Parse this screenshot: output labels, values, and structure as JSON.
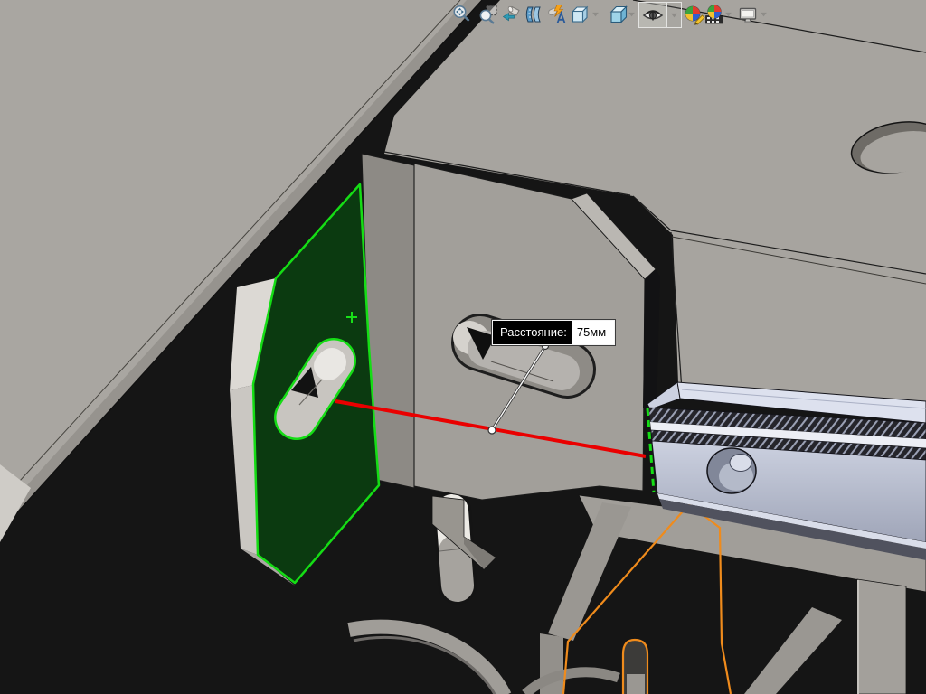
{
  "measurement": {
    "label": "Расстояние:",
    "value": "75мм"
  },
  "toolbar": {
    "buttons": [
      {
        "name": "zoom-to-fit"
      },
      {
        "name": "zoom-to-area"
      },
      {
        "name": "previous-view"
      },
      {
        "name": "section-view"
      },
      {
        "name": "dynamic-annotation-views"
      },
      {
        "name": "view-orientation",
        "has_dropdown": true
      },
      {
        "name": "display-style",
        "has_dropdown": true
      },
      {
        "name": "hide-show-items",
        "has_dropdown": true,
        "active": true
      },
      {
        "name": "edit-appearance"
      },
      {
        "name": "apply-scene",
        "has_dropdown": true
      },
      {
        "name": "view-settings",
        "has_dropdown": true
      }
    ]
  },
  "colors": {
    "selected_face_outline": "#15dd15",
    "selected_face_fill": "#0b3a10",
    "selected_edge": "#15dd15",
    "measure_line": "#ea0000",
    "hover_highlight": "#ef8b1c",
    "rail_body": "#c0c6d6",
    "surface_gray": "#a8a5a0",
    "shadow_background": "#151515"
  }
}
